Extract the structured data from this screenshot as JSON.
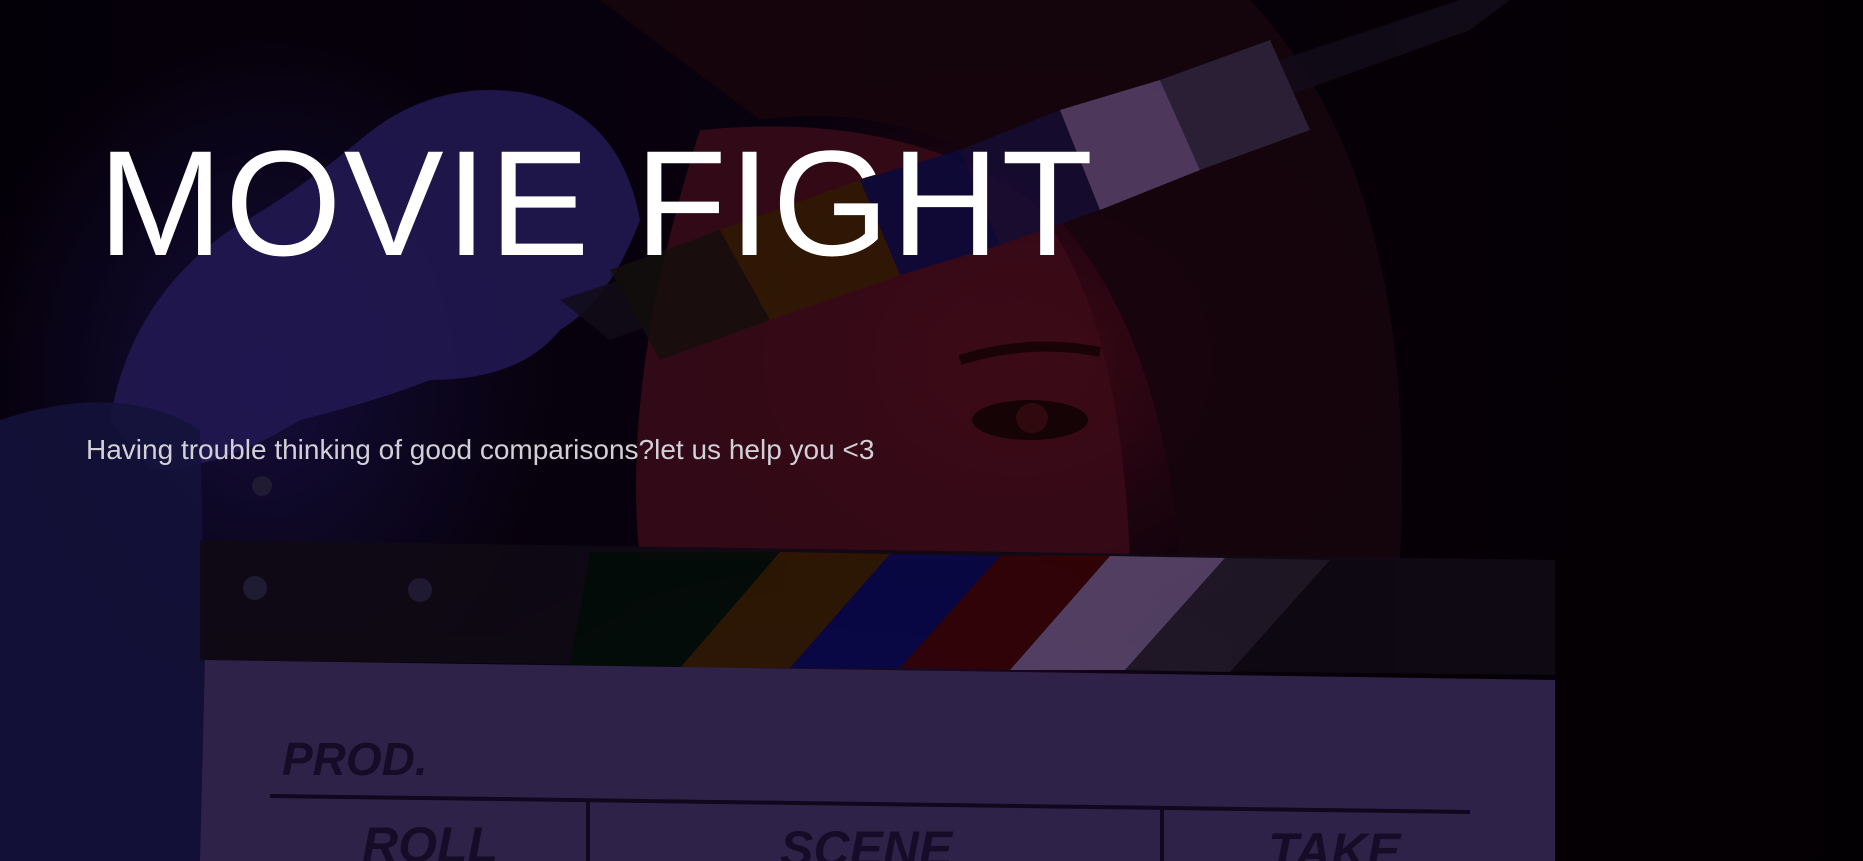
{
  "hero": {
    "title": "MOVIE FIGHT",
    "tagline": "Having trouble thinking of good comparisons?let us help you <3"
  },
  "background": {
    "image_subject": "person-behind-clapperboard",
    "clapperboard_labels": {
      "prod": "PROD.",
      "roll": "ROLL",
      "scene": "SCENE",
      "take": "TAKE"
    },
    "colors": {
      "red_light": "#8a1428",
      "blue_light": "#28207a",
      "board": "#3a2a5a"
    }
  }
}
